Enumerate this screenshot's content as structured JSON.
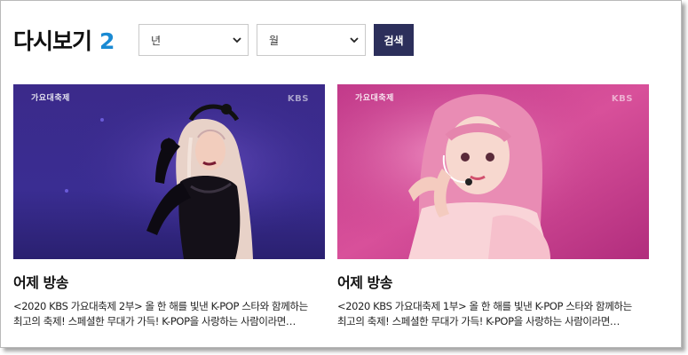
{
  "page": {
    "title": "다시보기",
    "count": "2"
  },
  "filters": {
    "year_placeholder": "년",
    "month_placeholder": "월",
    "search_label": "검색"
  },
  "videos": [
    {
      "title": "어제 방송",
      "desc_line1": "<2020 KBS 가요대축제 2부> 올 한 해를 빛낸 K-POP 스타와 함께하는",
      "desc_line2": "최고의 축제! 스페셜한 무대가 가득! K-POP을 사랑하는 사람이라면…",
      "watermark": "KBS",
      "show_logo": "가요대축제"
    },
    {
      "title": "어제 방송",
      "desc_line1": "<2020 KBS 가요대축제 1부> 올 한 해를 빛낸 K-POP 스타와 함께하는",
      "desc_line2": "최고의 축제! 스페셜한 무대가 가득! K-POP을 사랑하는 사람이라면…",
      "watermark": "KBS",
      "show_logo": "가요대축제"
    }
  ],
  "colors": {
    "accent": "#1a8ad3",
    "button": "#2c2f5b"
  }
}
